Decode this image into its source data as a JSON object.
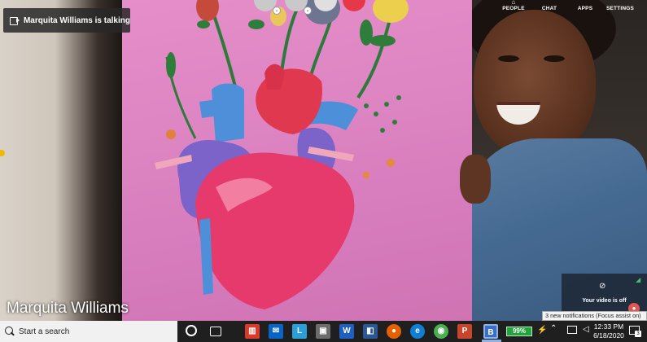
{
  "meeting": {
    "talking_indicator": "Marquita Williams is talking",
    "speaker_name": "Marquita Williams",
    "nav": [
      {
        "label": "PEOPLE",
        "icon": "people-icon"
      },
      {
        "label": "CHAT",
        "icon": "chat-icon"
      },
      {
        "label": "APPS",
        "icon": "apps-icon"
      },
      {
        "label": "SETTINGS",
        "icon": "settings-icon"
      }
    ],
    "video_off_text": "Your video is off",
    "accent_end_call": "#e5394a"
  },
  "notification": {
    "text": "3 new notifications (Focus assist on)"
  },
  "taskbar": {
    "search_placeholder": "Start a search",
    "battery": "99%",
    "time": "12:33 PM",
    "date": "6/18/2020",
    "action_center_count": "3",
    "apps": [
      {
        "name": "office-icon",
        "glyph": "▥"
      },
      {
        "name": "mail-icon",
        "glyph": "✉"
      },
      {
        "name": "lync-icon",
        "glyph": "L"
      },
      {
        "name": "store-icon",
        "glyph": "▣"
      },
      {
        "name": "word-icon",
        "glyph": "W"
      },
      {
        "name": "teams-icon",
        "glyph": "◧"
      },
      {
        "name": "firefox-icon",
        "glyph": "●"
      },
      {
        "name": "edge-icon",
        "glyph": "e"
      },
      {
        "name": "chrome-icon",
        "glyph": "◉"
      },
      {
        "name": "powerpoint-icon",
        "glyph": "P"
      },
      {
        "name": "bluejeans-icon",
        "glyph": "B"
      }
    ]
  }
}
